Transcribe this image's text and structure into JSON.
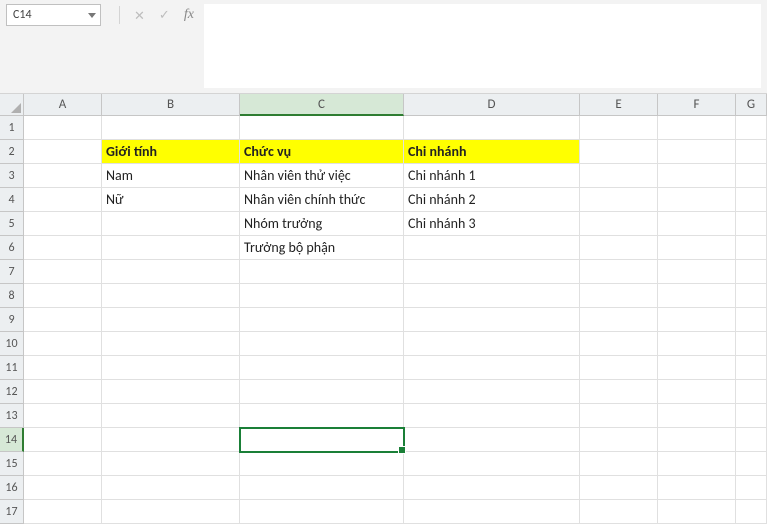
{
  "nameBox": {
    "value": "C14"
  },
  "formulaBar": {
    "cancel": "✕",
    "enter": "✓",
    "fx": "fx",
    "value": ""
  },
  "columns": [
    {
      "label": "A",
      "cls": "col-A"
    },
    {
      "label": "B",
      "cls": "col-B"
    },
    {
      "label": "C",
      "cls": "col-C"
    },
    {
      "label": "D",
      "cls": "col-D"
    },
    {
      "label": "E",
      "cls": "col-E"
    },
    {
      "label": "F",
      "cls": "col-F"
    },
    {
      "label": "G",
      "cls": "col-G"
    }
  ],
  "rows": [
    "1",
    "2",
    "3",
    "4",
    "5",
    "6",
    "7",
    "8",
    "9",
    "10",
    "11",
    "12",
    "13",
    "14",
    "15",
    "16",
    "17"
  ],
  "activeCol": "C",
  "activeRow": "14",
  "sheet": {
    "B2": {
      "v": "Giới tính",
      "hdr": true
    },
    "C2": {
      "v": "Chức vụ",
      "hdr": true
    },
    "D2": {
      "v": "Chi nhánh",
      "hdr": true
    },
    "B3": {
      "v": "Nam"
    },
    "C3": {
      "v": "Nhân viên thử việc"
    },
    "D3": {
      "v": "Chi nhánh 1"
    },
    "B4": {
      "v": "Nữ"
    },
    "C4": {
      "v": "Nhân viên chính thức"
    },
    "D4": {
      "v": "Chi nhánh 2"
    },
    "C5": {
      "v": "Nhóm trưởng"
    },
    "D5": {
      "v": "Chi nhánh 3"
    },
    "C6": {
      "v": "Trưởng bộ phận"
    }
  },
  "selection": {
    "colOffsetPx": 216,
    "rowOffsetPx": 312,
    "widthPx": 166,
    "heightPx": 26
  }
}
